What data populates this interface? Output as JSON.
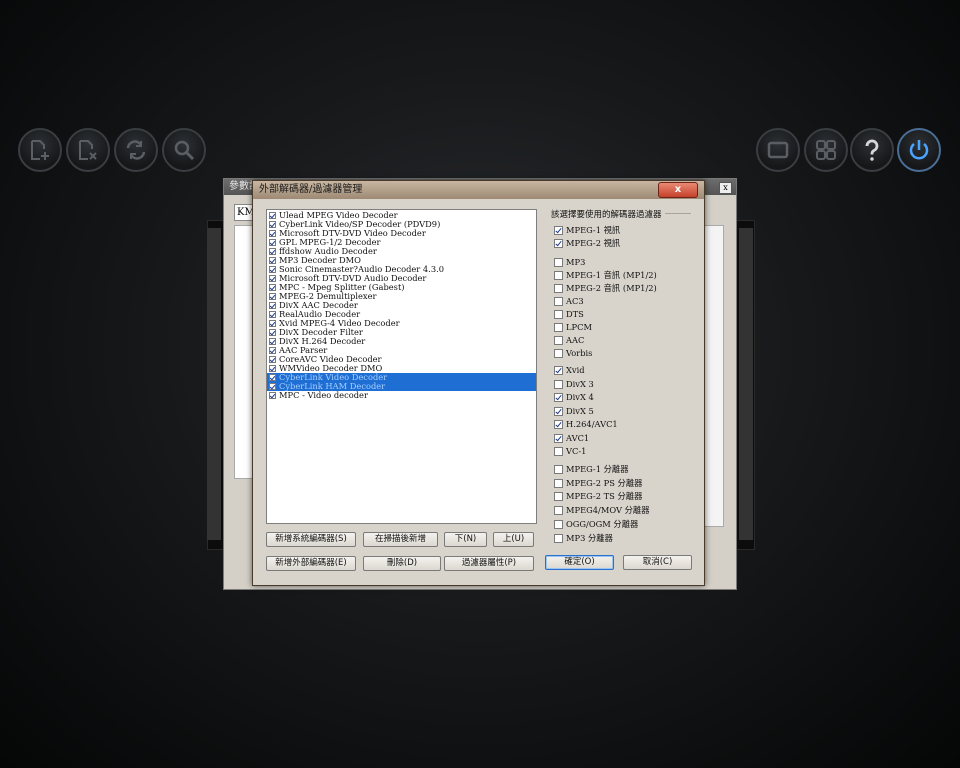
{
  "dialog": {
    "title": "外部解碼器/過濾器管理",
    "close_label": "x",
    "back_title": "參數設",
    "back_combo": "KMP",
    "back_close": "x"
  },
  "filters": [
    {
      "label": "Ulead MPEG Video Decoder",
      "checked": true,
      "selected": false
    },
    {
      "label": "CyberLink Video/SP Decoder (PDVD9)",
      "checked": true,
      "selected": false
    },
    {
      "label": "Microsoft DTV-DVD Video Decoder",
      "checked": true,
      "selected": false
    },
    {
      "label": "GPL MPEG-1/2 Decoder",
      "checked": true,
      "selected": false
    },
    {
      "label": "ffdshow Audio Decoder",
      "checked": true,
      "selected": false
    },
    {
      "label": "MP3 Decoder DMO",
      "checked": true,
      "selected": false
    },
    {
      "label": "Sonic Cinemaster?Audio Decoder 4.3.0",
      "checked": true,
      "selected": false
    },
    {
      "label": "Microsoft DTV-DVD Audio Decoder",
      "checked": true,
      "selected": false
    },
    {
      "label": "MPC - Mpeg Splitter (Gabest)",
      "checked": true,
      "selected": false
    },
    {
      "label": "MPEG-2 Demultiplexer",
      "checked": true,
      "selected": false
    },
    {
      "label": "DivX AAC Decoder",
      "checked": true,
      "selected": false
    },
    {
      "label": "RealAudio Decoder",
      "checked": true,
      "selected": false
    },
    {
      "label": "Xvid MPEG-4 Video Decoder",
      "checked": true,
      "selected": false
    },
    {
      "label": "DivX Decoder Filter",
      "checked": true,
      "selected": false
    },
    {
      "label": "DivX H.264 Decoder",
      "checked": true,
      "selected": false
    },
    {
      "label": "AAC Parser",
      "checked": true,
      "selected": false
    },
    {
      "label": "CoreAVC Video Decoder",
      "checked": true,
      "selected": false
    },
    {
      "label": "WMVideo Decoder DMO",
      "checked": true,
      "selected": false
    },
    {
      "label": "CyberLink Video Decoder",
      "checked": true,
      "selected": true
    },
    {
      "label": "CyberLink HAM Decoder",
      "checked": true,
      "selected": true
    },
    {
      "label": "MPC - Video decoder",
      "checked": true,
      "selected": false
    }
  ],
  "buttons": {
    "add_system": "新增系統編碼器(S)",
    "scan_add": "在掃描後新增",
    "down": "下(N)",
    "up": "上(U)",
    "add_external": "新增外部編碼器(E)",
    "delete": "刪除(D)",
    "properties": "過濾器屬性(P)",
    "ok": "確定(O)",
    "cancel": "取消(C)"
  },
  "group": {
    "title": "該選擇要使用的解碼器過濾器",
    "options": [
      {
        "label": "MPEG-1 視訊",
        "checked": true
      },
      {
        "label": "MPEG-2 視訊",
        "checked": true
      },
      {
        "label": "MP3",
        "checked": false
      },
      {
        "label": "MPEG-1 音訊 (MP1/2)",
        "checked": false
      },
      {
        "label": "MPEG-2 音訊 (MP1/2)",
        "checked": false
      },
      {
        "label": "AC3",
        "checked": false
      },
      {
        "label": "DTS",
        "checked": false
      },
      {
        "label": "LPCM",
        "checked": false
      },
      {
        "label": "AAC",
        "checked": false
      },
      {
        "label": "Vorbis",
        "checked": false
      },
      {
        "label": "Xvid",
        "checked": true
      },
      {
        "label": "DivX 3",
        "checked": false
      },
      {
        "label": "DivX 4",
        "checked": true
      },
      {
        "label": "DivX 5",
        "checked": true
      },
      {
        "label": "H.264/AVC1",
        "checked": true
      },
      {
        "label": "AVC1",
        "checked": true
      },
      {
        "label": "VC-1",
        "checked": false
      },
      {
        "label": "MPEG-1 分離器",
        "checked": false
      },
      {
        "label": "MPEG-2 PS 分離器",
        "checked": false
      },
      {
        "label": "MPEG-2 TS 分離器",
        "checked": false
      },
      {
        "label": "MPEG4/MOV 分離器",
        "checked": false
      },
      {
        "label": "OGG/OGM 分離器",
        "checked": false
      },
      {
        "label": "MP3 分離器",
        "checked": false
      }
    ]
  },
  "icons": [
    "add-file-icon",
    "remove-file-icon",
    "repeat-icon",
    "search-icon",
    "screen-icon",
    "grid-icon",
    "help-icon",
    "power-icon"
  ]
}
